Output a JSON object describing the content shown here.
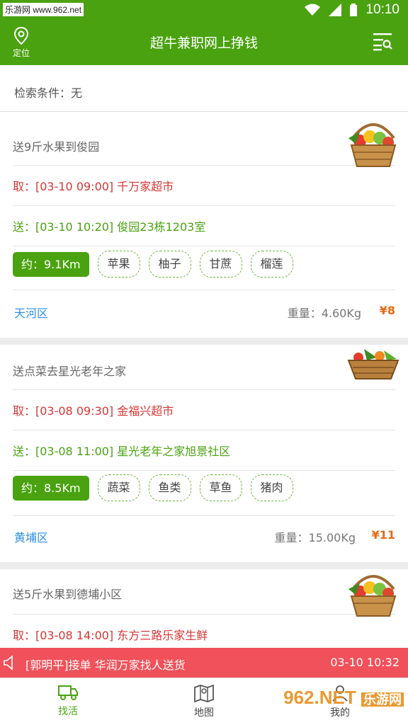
{
  "status_bar": {
    "watermark": "乐游网 www.962.net",
    "time": "10:10"
  },
  "header": {
    "location_label": "定位",
    "title": "超牛兼职网上挣钱"
  },
  "search_condition": {
    "label": "检索条件：",
    "value": "无"
  },
  "orders": [
    {
      "title": "送9斤水果到俊园",
      "pickup": "取：[03-10 09:00] 千万家超市",
      "deliver": "送：[03-10 10:20] 俊园23栋1203室",
      "distance": "约：9.1Km",
      "tags": [
        "苹果",
        "柚子",
        "甘蔗",
        "榴莲"
      ],
      "area": "天河区",
      "weight_label": "重量：",
      "weight": "4.60Kg",
      "price": "¥8"
    },
    {
      "title": "送点菜去星光老年之家",
      "pickup": "取：[03-08 09:30] 金福兴超市",
      "deliver": "送：[03-08 11:00] 星光老年之家旭景社区",
      "distance": "约：8.5Km",
      "tags": [
        "蔬菜",
        "鱼类",
        "草鱼",
        "猪肉"
      ],
      "area": "黄埔区",
      "weight_label": "重量：",
      "weight": "15.00Kg",
      "price": "¥11"
    },
    {
      "title": "送5斤水果到德埔小区",
      "pickup": "取：[03-08 14:00] 东方三路乐家生鲜"
    }
  ],
  "notice": {
    "message": "[郭明平]接单 华润万家找人送货",
    "time": "03-10 10:32"
  },
  "tabs": [
    {
      "label": "找活",
      "icon": "truck-icon",
      "active": true
    },
    {
      "label": "地图",
      "icon": "map-icon",
      "active": false
    },
    {
      "label": "我的",
      "icon": "user-icon",
      "active": false
    }
  ],
  "watermark_logo": {
    "text": "962",
    "suffix": ".NET",
    "sub": "乐游网"
  },
  "colors": {
    "primary_green": "#4aa210",
    "pickup_red": "#d43636",
    "area_blue": "#2f8fe0",
    "price_orange": "#e86a14",
    "notice_red": "#f0515a"
  }
}
